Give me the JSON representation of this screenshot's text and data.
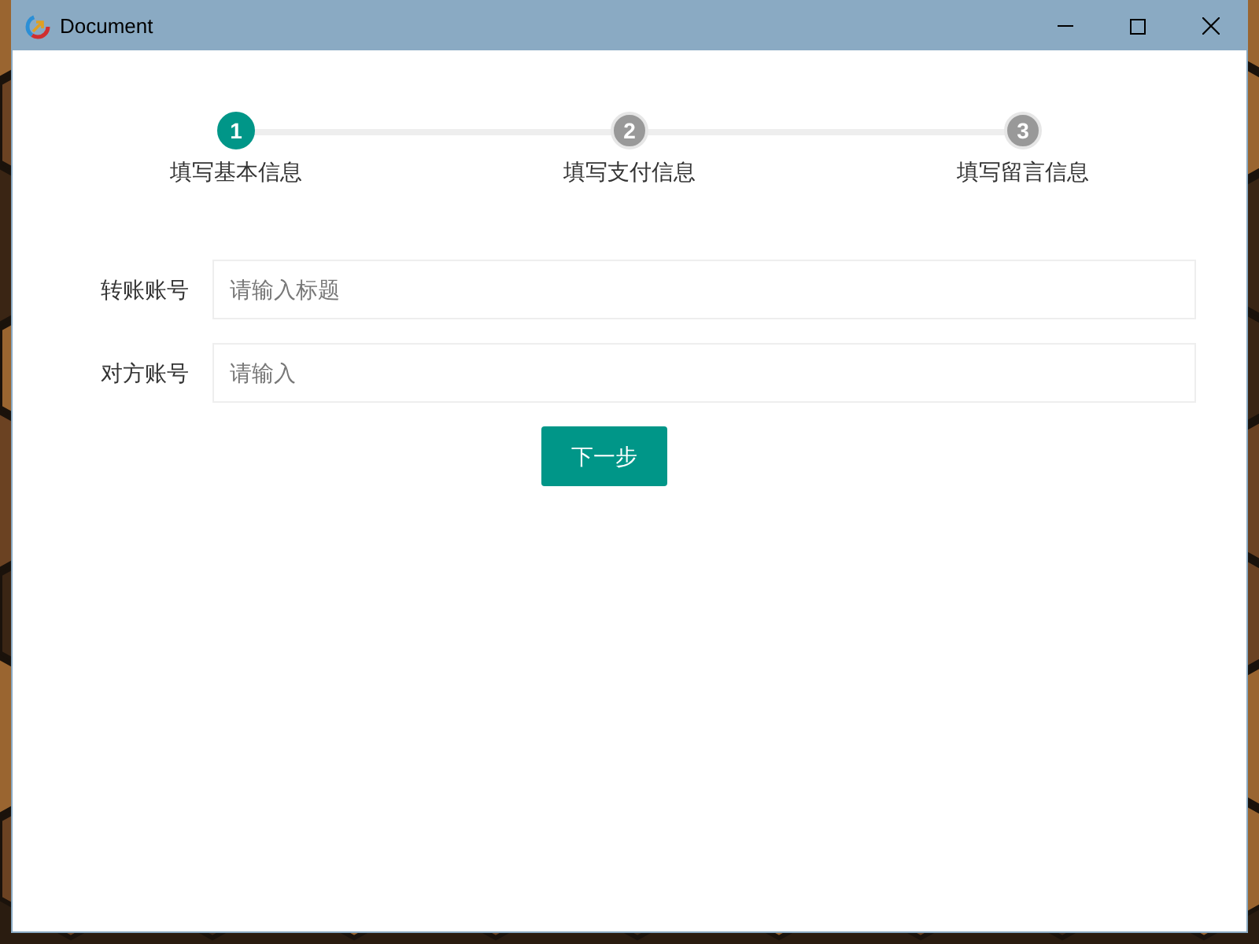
{
  "window": {
    "title": "Document"
  },
  "steps": [
    {
      "number": "1",
      "label": "填写基本信息",
      "selected": true
    },
    {
      "number": "2",
      "label": "填写支付信息",
      "selected": false
    },
    {
      "number": "3",
      "label": "填写留言信息",
      "selected": false
    }
  ],
  "fields": [
    {
      "label": "转账账号",
      "placeholder": "请输入标题"
    },
    {
      "label": "对方账号",
      "placeholder": "请输入"
    }
  ],
  "next_button": "下一步"
}
